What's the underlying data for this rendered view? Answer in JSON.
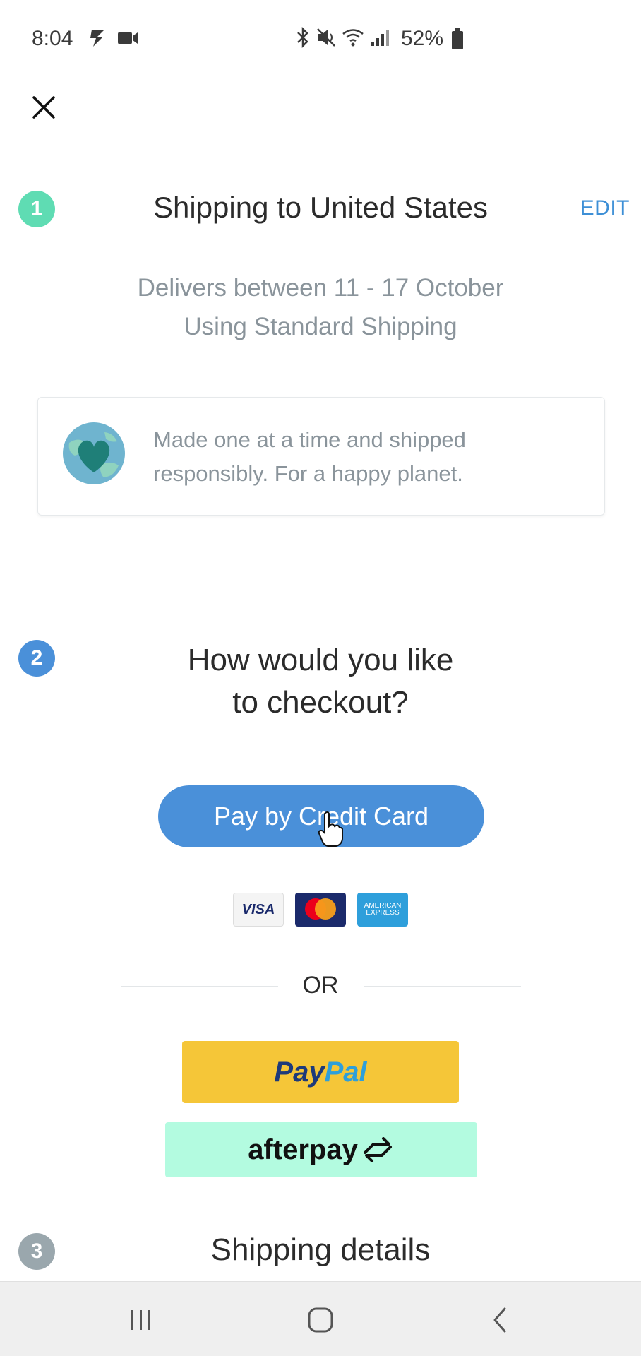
{
  "status_bar": {
    "time": "8:04",
    "battery": "52%",
    "left_icons": [
      "flash-icon",
      "video-icon"
    ],
    "right_icons": [
      "bluetooth-icon",
      "mute-icon",
      "wifi-icon",
      "signal-icon",
      "battery-icon"
    ]
  },
  "header": {
    "close_icon": "close-icon"
  },
  "step1": {
    "number": "1",
    "title": "Shipping to United States",
    "edit_label": "EDIT",
    "deliver_line1": "Delivers between 11 - 17 October",
    "deliver_line2": "Using Standard Shipping",
    "eco_line1": "Made one at a time and shipped",
    "eco_line2": "responsibly. For a happy planet.",
    "eco_icon": "globe-heart-icon"
  },
  "step2": {
    "number": "2",
    "title_line1": "How would you like",
    "title_line2": "to checkout?",
    "credit_card_button": "Pay by Credit Card",
    "card_brands": [
      "VISA",
      "Mastercard",
      "American Express"
    ],
    "visa_label": "VISA",
    "amex_line1": "AMERICAN",
    "amex_line2": "EXPRESS",
    "or_label": "OR",
    "paypal_pay": "Pay",
    "paypal_pal": "Pal",
    "afterpay_label": "afterpay"
  },
  "step3": {
    "number": "3",
    "title": "Shipping details"
  },
  "nav": {
    "icons": [
      "recent-apps-icon",
      "home-icon",
      "back-icon"
    ]
  },
  "colors": {
    "accent_blue": "#4a90d9",
    "step1_green": "#5fdcb3",
    "step3_grey": "#9aa7ad",
    "paypal_yellow": "#f5c638",
    "afterpay_mint": "#b3fbe0"
  }
}
